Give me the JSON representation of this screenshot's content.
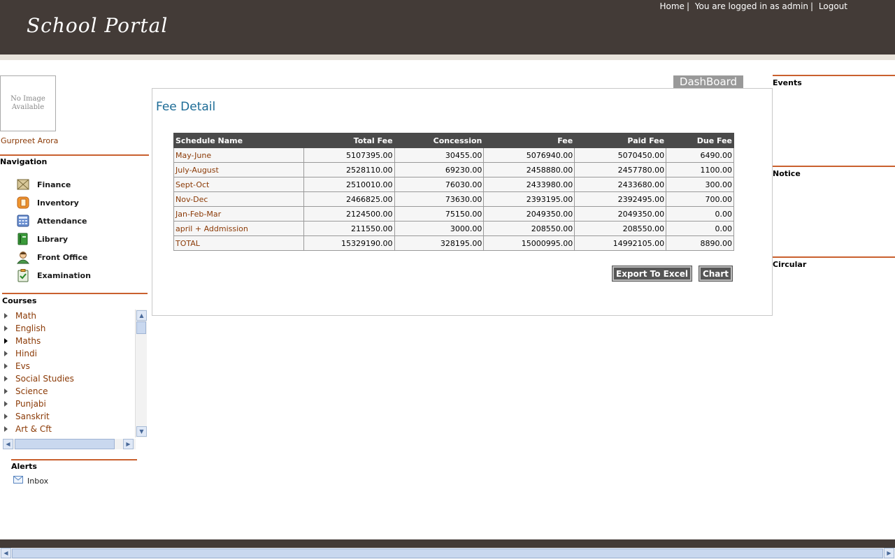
{
  "header": {
    "logo": "School Portal",
    "home_link": "Home",
    "login_status": "You are logged in as admin",
    "logout_link": "Logout",
    "sep": "|"
  },
  "profile": {
    "no_image_text": "No Image Available",
    "name": "Gurpreet Arora"
  },
  "navigation": {
    "title": "Navigation",
    "items": [
      {
        "label": "Finance",
        "icon": "finance-icon"
      },
      {
        "label": "Inventory",
        "icon": "inventory-icon"
      },
      {
        "label": "Attendance",
        "icon": "attendance-icon"
      },
      {
        "label": "Library",
        "icon": "library-icon"
      },
      {
        "label": "Front Office",
        "icon": "front-office-icon"
      },
      {
        "label": "Examination",
        "icon": "examination-icon"
      }
    ]
  },
  "courses": {
    "title": "Courses",
    "items": [
      "Math",
      "English",
      "Maths",
      "Hindi",
      "Evs",
      "Social Studies",
      "Science",
      "Punjabi",
      "Sanskrit",
      "Art & Cft"
    ]
  },
  "alerts": {
    "title": "Alerts",
    "inbox_label": "Inbox"
  },
  "dashboard_tab": "DashBoard",
  "fee_detail": {
    "title": "Fee Detail",
    "columns": [
      "Schedule Name",
      "Total Fee",
      "Concession",
      "Fee",
      "Paid Fee",
      "Due Fee"
    ],
    "rows": [
      [
        "May-June",
        "5107395.00",
        "30455.00",
        "5076940.00",
        "5070450.00",
        "6490.00"
      ],
      [
        "July-August",
        "2528110.00",
        "69230.00",
        "2458880.00",
        "2457780.00",
        "1100.00"
      ],
      [
        "Sept-Oct",
        "2510010.00",
        "76030.00",
        "2433980.00",
        "2433680.00",
        "300.00"
      ],
      [
        "Nov-Dec",
        "2466825.00",
        "73630.00",
        "2393195.00",
        "2392495.00",
        "700.00"
      ],
      [
        "Jan-Feb-Mar",
        "2124500.00",
        "75150.00",
        "2049350.00",
        "2049350.00",
        "0.00"
      ],
      [
        "april + Addmission",
        "211550.00",
        "3000.00",
        "208550.00",
        "208550.00",
        "0.00"
      ],
      [
        "TOTAL",
        "15329190.00",
        "328195.00",
        "15000995.00",
        "14992105.00",
        "8890.00"
      ]
    ],
    "export_button": "Export To Excel",
    "chart_button": "Chart"
  },
  "right_panel": {
    "events_title": "Events",
    "notice_title": "Notice",
    "circular_title": "Circular"
  },
  "colors": {
    "header_bg": "#433b37",
    "accent_rule": "#c9602e",
    "link_text": "#8b3a06",
    "title_blue": "#1c6b96"
  }
}
